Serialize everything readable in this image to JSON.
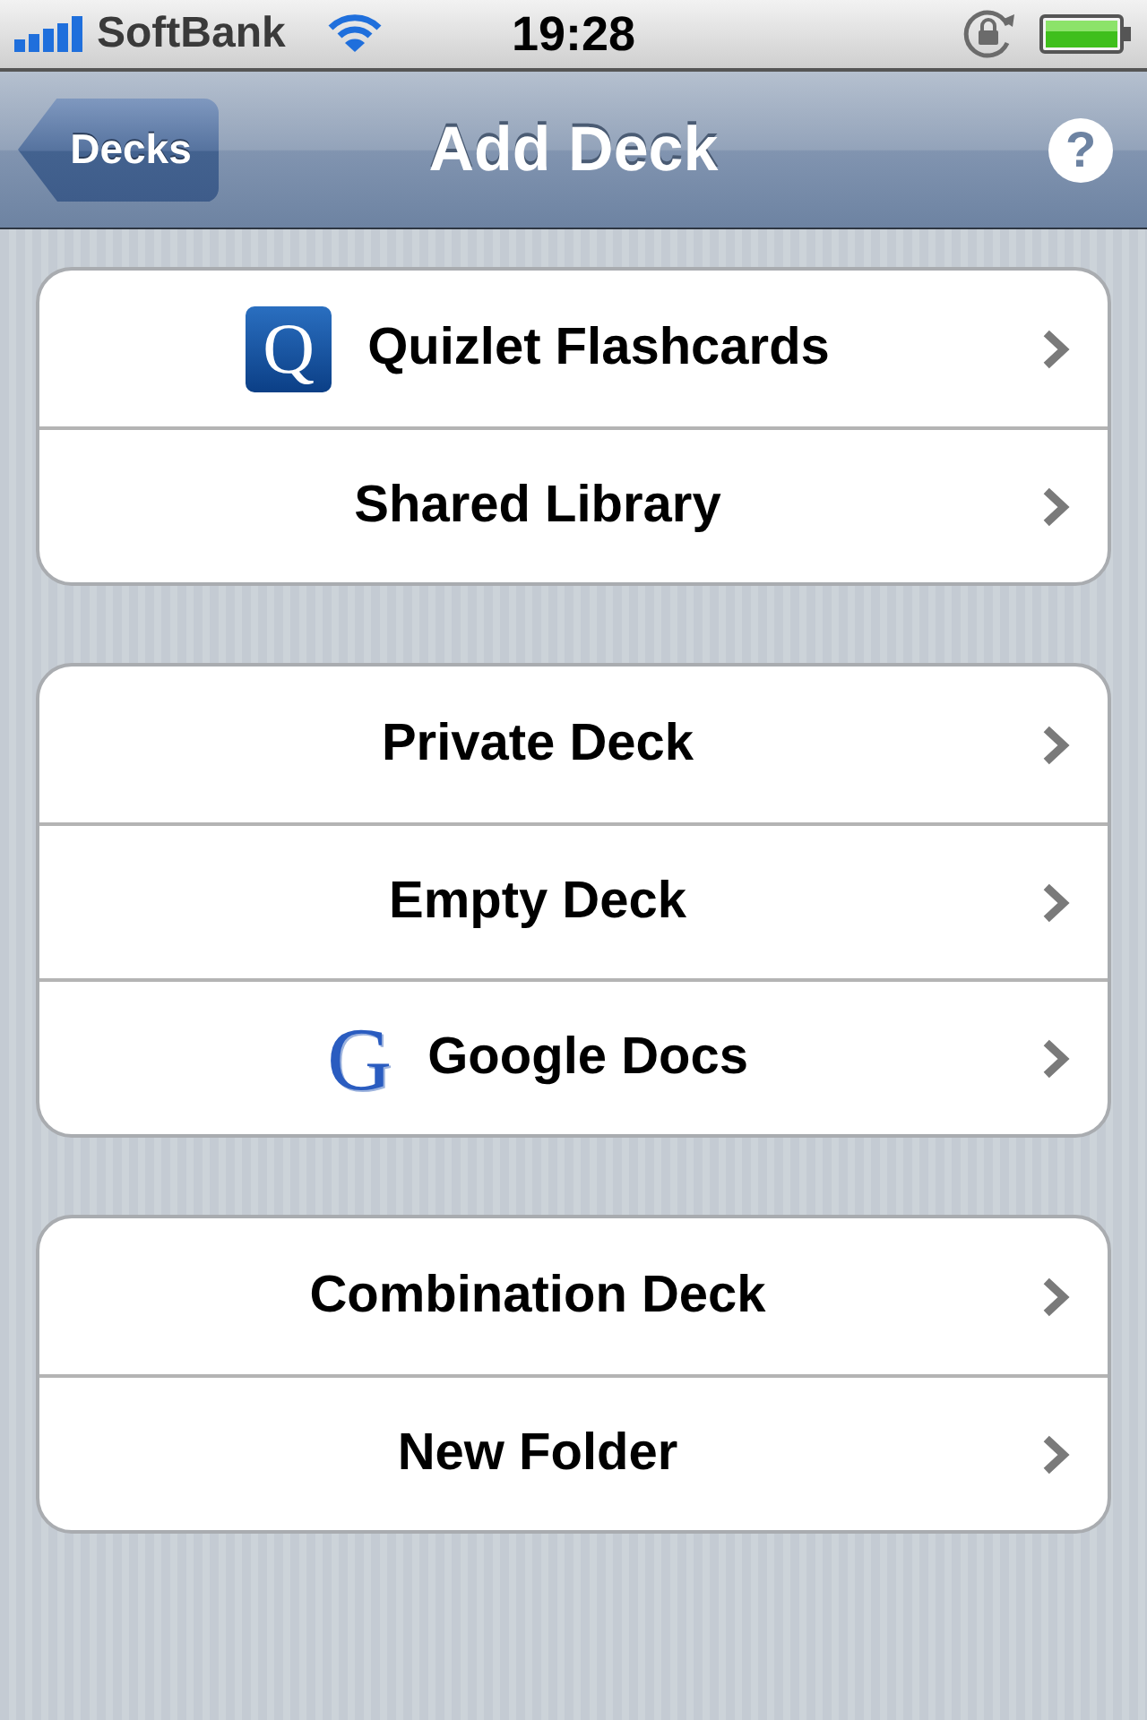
{
  "status_bar": {
    "carrier": "SoftBank",
    "time": "19:28"
  },
  "nav_bar": {
    "back_button": "Decks",
    "title": "Add Deck",
    "help_button": "?"
  },
  "groups": [
    {
      "rows": [
        {
          "kind": "q-logo",
          "icon_letter": "Q",
          "label": "Quizlet Flashcards"
        },
        {
          "kind": "plain",
          "label": "Shared Library"
        }
      ]
    },
    {
      "rows": [
        {
          "kind": "plain",
          "label": "Private Deck"
        },
        {
          "kind": "plain",
          "label": "Empty Deck"
        },
        {
          "kind": "g-logo",
          "icon_letter": "G",
          "label": "Google Docs"
        }
      ]
    },
    {
      "rows": [
        {
          "kind": "plain",
          "label": "Combination Deck"
        },
        {
          "kind": "plain",
          "label": "New Folder"
        }
      ]
    }
  ]
}
